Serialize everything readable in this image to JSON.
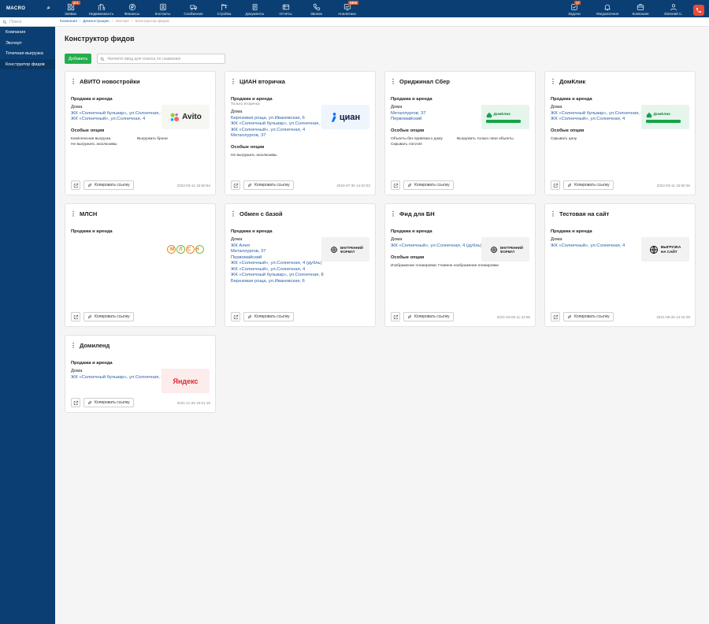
{
  "app": {
    "logo": "MACRO"
  },
  "nav": [
    {
      "label": "Заявки",
      "badge": "871",
      "icon": "grid-icon"
    },
    {
      "label": "Недвижимость",
      "badge": "",
      "icon": "buildings-icon"
    },
    {
      "label": "Финансы",
      "badge": "",
      "icon": "ruble-icon"
    },
    {
      "label": "Контакты",
      "badge": "",
      "icon": "contacts-icon"
    },
    {
      "label": "Снабжение",
      "badge": "",
      "icon": "truck-icon"
    },
    {
      "label": "Стройка",
      "badge": "",
      "icon": "crane-icon"
    },
    {
      "label": "Документы",
      "badge": "",
      "icon": "documents-icon"
    },
    {
      "label": "Отчёты",
      "badge": "",
      "icon": "reports-icon"
    },
    {
      "label": "Звонки",
      "badge": "",
      "icon": "phone-icon"
    },
    {
      "label": "Аналитика",
      "badge": "NEW",
      "icon": "analytics-icon"
    }
  ],
  "nav_right": [
    {
      "label": "Задачи",
      "badge": "17",
      "icon": "tasks-icon"
    },
    {
      "label": "Уведомления",
      "badge": "",
      "icon": "bell-icon"
    },
    {
      "label": "Компания",
      "badge": "",
      "icon": "briefcase-icon"
    },
    {
      "label": "Евгений С.",
      "badge": "",
      "icon": "user-icon"
    }
  ],
  "sidebar": {
    "search_placeholder": "Поиск",
    "items": [
      {
        "label": "Компания"
      },
      {
        "label": "Экспорт"
      },
      {
        "label": "Точечная выгрузка"
      },
      {
        "label": "Конструктор фидов"
      }
    ]
  },
  "breadcrumb": [
    "Компания",
    "Демонстрацию",
    "Экспорт",
    "Конструктор фидов"
  ],
  "page": {
    "title": "Конструктор фидов",
    "add_label": "Добавить",
    "search_placeholder": "Начните ввод для поиска по названию",
    "copy_label": "Копировать ссылку"
  },
  "colors": {
    "header": "#0b3f73",
    "accent_green": "#23ad4e",
    "link": "#2a62a8",
    "danger": "#e84a3a"
  },
  "cards": [
    {
      "title": "АВИТО новостройки",
      "section": "Продажа и аренда",
      "sub": "",
      "kind": "Дома",
      "links": [
        "ЖК «Солнечный бульвар», ул.Солнечная, 8",
        "ЖК «Солнечный», ул.Солнечная, 4"
      ],
      "options_title": "Особые опции",
      "options": [
        "Комплексная выгрузка",
        "Выгружать брони",
        "Не выгружать эксклюзивы"
      ],
      "date": "2022-03-11 16:50:54",
      "logo": "Avito"
    },
    {
      "title": "ЦИАН вторичка",
      "section": "Продажа и аренда",
      "sub": "Только вторичка",
      "kind": "Дома",
      "links": [
        "Березовая роща, ул.Ивановская, 6",
        "ЖК «Солнечный бульвар», ул.Солнечная, 8",
        "ЖК «Солнечный», ул.Солнечная, 4",
        "Металлургов, 37"
      ],
      "options_title": "Особые опции",
      "options": [
        "Не выгружать эксклюзивы"
      ],
      "date": "2019-07-30 14:02:52",
      "logo": "циан"
    },
    {
      "title": "Ориджинал Сбер",
      "section": "Продажа и аренда",
      "sub": "",
      "kind": "Дома",
      "links": [
        "Металлургов, 37",
        "Первомайский"
      ],
      "options_title": "Особые опции",
      "options": [
        "Объекты без привязки к дому",
        "Выгружать только свои объекты",
        "Скрывать логотип"
      ],
      "date": "",
      "logo": "ДомКлик"
    },
    {
      "title": "ДомКлик",
      "section": "Продажа и аренда",
      "sub": "",
      "kind": "Дома",
      "links": [
        "ЖК «Солнечный бульвар», ул.Солнечная, 8",
        "ЖК «Солнечный», ул.Солнечная, 4"
      ],
      "options_title": "Особые опции",
      "options": [
        "Скрывать цену"
      ],
      "date": "2022-03-11 16:50:45",
      "logo": "ДомКлик"
    },
    {
      "title": "МЛСН",
      "section": "Продажа и аренда",
      "sub": "",
      "kind": "",
      "links": [],
      "options_title": "",
      "options": [],
      "date": "",
      "logo": "МЛСН"
    },
    {
      "title": "Обмен с базой",
      "section": "Продажа и аренда",
      "sub": "",
      "kind": "Дома",
      "links": [
        "ЖК Алея",
        "Металлургов, 37",
        "Первомайский",
        "ЖК «Солнечный», ул.Солнечная, 4 (дубль)",
        "ЖК «Солнечный», ул.Солнечная, 4",
        "ЖК «Солнечный бульвар», ул.Солнечная, 8",
        "Березовая роща, ул.Ивановская, 6"
      ],
      "options_title": "",
      "options": [],
      "date": "",
      "logo": "ВНУТРЕННИЙ ФОРМАТ"
    },
    {
      "title": "Фид для БН",
      "section": "Продажа и аренда",
      "sub": "",
      "kind": "Дома",
      "links": [
        "ЖК «Солнечный», ул.Солнечная, 4 (дубль)"
      ],
      "options_title": "Особые опции",
      "options": [
        "Изображение планировки: Главное изображение планировки"
      ],
      "date": "2021-03-05 11:42:56",
      "logo": "ВНУТРЕННИЙ ФОРМАТ"
    },
    {
      "title": "Тестовая на сайт",
      "section": "Продажа и аренда",
      "sub": "",
      "kind": "Дома",
      "links": [
        "ЖК «Солнечный», ул.Солнечная, 4"
      ],
      "options_title": "",
      "options": [],
      "date": "2021-08-26 14:15:38",
      "logo": "ВЫГРУЗКА НА САЙТ"
    },
    {
      "title": "Домиленд",
      "section": "Продажа и аренда",
      "sub": "",
      "kind": "Дома",
      "links": [
        "ЖК «Солнечный бульвар», ул.Солнечная, 8"
      ],
      "options_title": "",
      "options": [],
      "date": "2021-11-26 16:01:19",
      "logo": "Яндекс"
    }
  ]
}
